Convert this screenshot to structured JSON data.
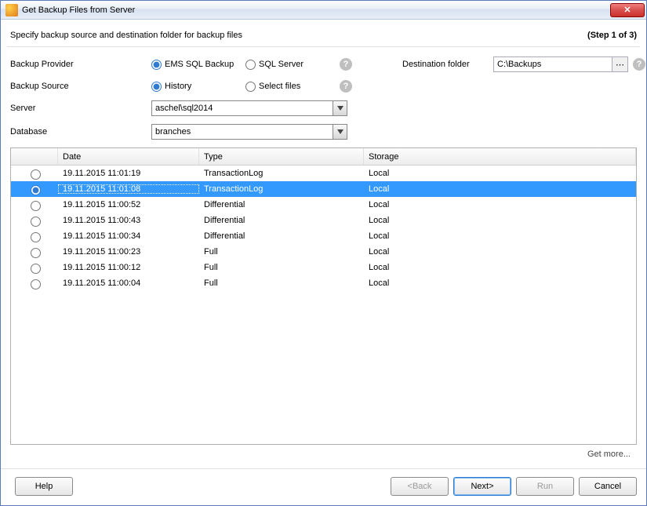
{
  "window": {
    "title": "Get Backup Files from Server"
  },
  "header": {
    "instruction": "Specify backup source and destination folder for backup files",
    "step": "(Step 1 of 3)"
  },
  "form": {
    "backup_provider_label": "Backup Provider",
    "provider_ems": "EMS SQL Backup",
    "provider_sql": "SQL Server",
    "backup_source_label": "Backup Source",
    "source_history": "History",
    "source_select": "Select files",
    "server_label": "Server",
    "server_value": "aschel\\sql2014",
    "database_label": "Database",
    "database_value": "branches",
    "dest_label": "Destination folder",
    "dest_value": "C:\\Backups"
  },
  "table": {
    "columns": {
      "date": "Date",
      "type": "Type",
      "storage": "Storage"
    },
    "rows": [
      {
        "date": "19.11.2015 11:01:19",
        "type": "TransactionLog",
        "storage": "Local",
        "selected": false
      },
      {
        "date": "19.11.2015 11:01:08",
        "type": "TransactionLog",
        "storage": "Local",
        "selected": true
      },
      {
        "date": "19.11.2015 11:00:52",
        "type": "Differential",
        "storage": "Local",
        "selected": false
      },
      {
        "date": "19.11.2015 11:00:43",
        "type": "Differential",
        "storage": "Local",
        "selected": false
      },
      {
        "date": "19.11.2015 11:00:34",
        "type": "Differential",
        "storage": "Local",
        "selected": false
      },
      {
        "date": "19.11.2015 11:00:23",
        "type": "Full",
        "storage": "Local",
        "selected": false
      },
      {
        "date": "19.11.2015 11:00:12",
        "type": "Full",
        "storage": "Local",
        "selected": false
      },
      {
        "date": "19.11.2015 11:00:04",
        "type": "Full",
        "storage": "Local",
        "selected": false
      }
    ],
    "getmore": "Get more..."
  },
  "buttons": {
    "help": "Help",
    "back": "<Back",
    "next": "Next>",
    "run": "Run",
    "cancel": "Cancel"
  }
}
